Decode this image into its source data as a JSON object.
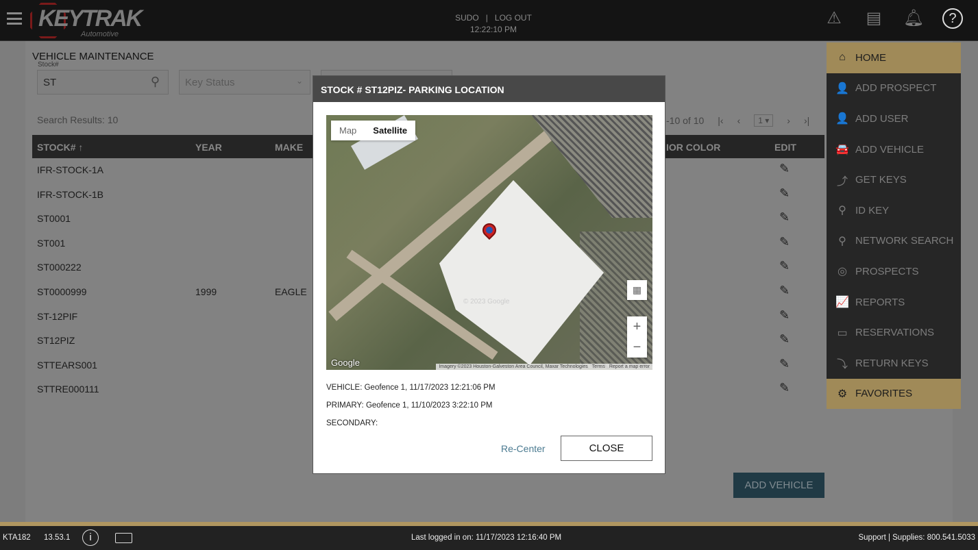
{
  "header": {
    "logo_text": "KEYTRAK",
    "logo_sub": "Automotive",
    "user": "SUDO",
    "logout": "LOG OUT",
    "sep": "|",
    "time": "12:22:10 PM",
    "icons": [
      "warning-icon",
      "key-card-icon",
      "bell-icon",
      "help-icon"
    ]
  },
  "page": {
    "title": "VEHICLE MAINTENANCE",
    "stock_label": "Stock#",
    "stock_value": "ST",
    "key_status_placeholder": "Key Status",
    "search_results": "Search Results: 10",
    "pager": {
      "range": "-10 of 10",
      "page": "1"
    }
  },
  "table": {
    "columns": [
      "STOCK# ↑",
      "YEAR",
      "MAKE",
      "IOR COLOR",
      "EDIT"
    ],
    "rows": [
      {
        "stock": "IFR-STOCK-1A",
        "year": "",
        "make": ""
      },
      {
        "stock": "IFR-STOCK-1B",
        "year": "",
        "make": ""
      },
      {
        "stock": "ST0001",
        "year": "",
        "make": ""
      },
      {
        "stock": "ST001",
        "year": "",
        "make": ""
      },
      {
        "stock": "ST000222",
        "year": "",
        "make": ""
      },
      {
        "stock": "ST0000999",
        "year": "1999",
        "make": "EAGLE"
      },
      {
        "stock": "ST-12PIF",
        "year": "",
        "make": ""
      },
      {
        "stock": "ST12PIZ",
        "year": "",
        "make": ""
      },
      {
        "stock": "STTEARS001",
        "year": "",
        "make": ""
      },
      {
        "stock": "STTRE000111",
        "year": "",
        "make": ""
      }
    ]
  },
  "add_vehicle_button": "ADD VEHICLE",
  "menu": [
    {
      "label": "HOME",
      "icon": "⌂",
      "active": true
    },
    {
      "label": "ADD PROSPECT",
      "icon": "👤"
    },
    {
      "label": "ADD USER",
      "icon": "👤"
    },
    {
      "label": "ADD VEHICLE",
      "icon": "🚘"
    },
    {
      "label": "GET KEYS",
      "icon": "⤴"
    },
    {
      "label": "ID KEY",
      "icon": "⚲"
    },
    {
      "label": "NETWORK SEARCH",
      "icon": "⚲"
    },
    {
      "label": "PROSPECTS",
      "icon": "◎"
    },
    {
      "label": "REPORTS",
      "icon": "📈"
    },
    {
      "label": "RESERVATIONS",
      "icon": "▭"
    },
    {
      "label": "RETURN KEYS",
      "icon": "⤵"
    },
    {
      "label": "FAVORITES",
      "icon": "⚙",
      "active": true
    }
  ],
  "modal": {
    "title": "STOCK # ST12PIZ- PARKING LOCATION",
    "map_tabs": [
      "Map",
      "Satellite"
    ],
    "map_active": "Satellite",
    "google": "Google",
    "attribution": "Imagery ©2023 Houston-Galveston Area Council, Maxar Technologies",
    "terms": "Terms",
    "report": "Report a map error",
    "watermark": "© 2023 Google",
    "pin_label": "P",
    "vehicle": "VEHICLE: Geofence 1, 11/17/2023 12:21:06 PM",
    "primary": "PRIMARY: Geofence 1, 11/10/2023 3:22:10 PM",
    "secondary": "SECONDARY:",
    "recenter": "Re-Center",
    "close": "CLOSE"
  },
  "footer": {
    "terminal": "KTA182",
    "version": "13.53.1",
    "last_login": "Last logged in on: 11/17/2023 12:16:40 PM",
    "support": "Support | Supplies: 800.541.5033"
  },
  "colors": {
    "gold": "#b09660",
    "header": "#141414",
    "modal_header": "#484848",
    "link": "#4a7a90"
  }
}
